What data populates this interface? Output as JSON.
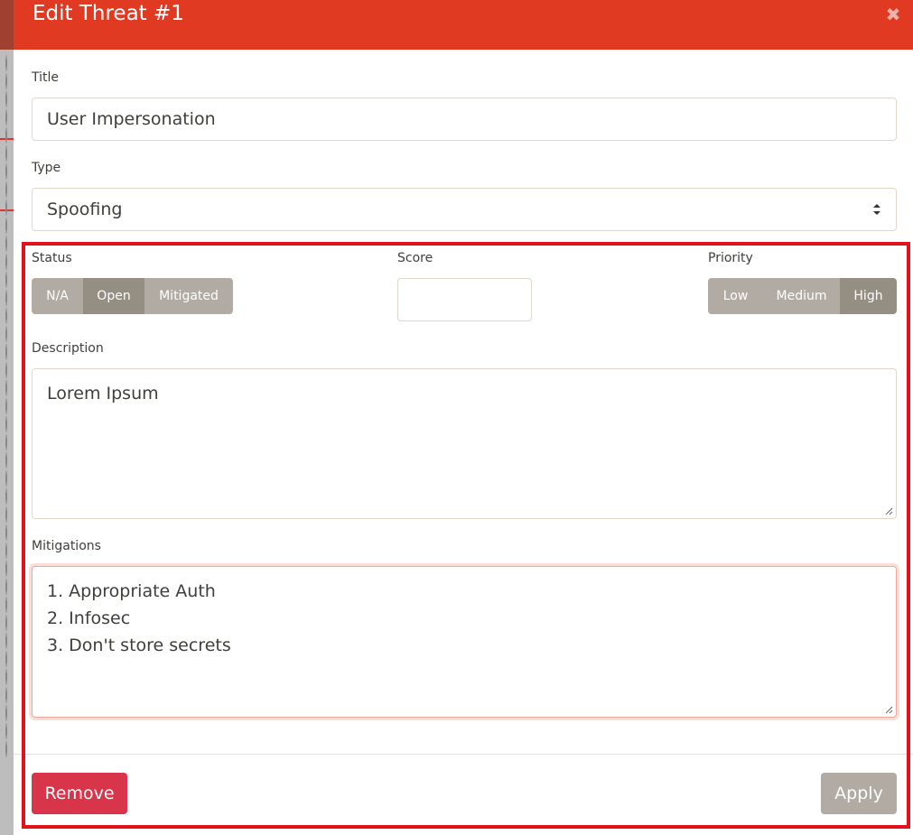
{
  "modal": {
    "title": "Edit Threat #1",
    "close_icon": "close-icon",
    "header_color": "#e03a22"
  },
  "form": {
    "title_label": "Title",
    "title_value": "User Impersonation",
    "type_label": "Type",
    "type_value": "Spoofing",
    "status_label": "Status",
    "status_options": [
      "N/A",
      "Open",
      "Mitigated"
    ],
    "status_selected": "Open",
    "score_label": "Score",
    "score_value": "",
    "priority_label": "Priority",
    "priority_options": [
      "Low",
      "Medium",
      "High"
    ],
    "priority_selected": "High",
    "description_label": "Description",
    "description_value": "Lorem Ipsum",
    "mitigations_label": "Mitigations",
    "mitigations_lines": [
      "1. Appropriate Auth",
      "2. Infosec",
      "3. Don't store secrets"
    ]
  },
  "footer": {
    "remove_label": "Remove",
    "apply_label": "Apply"
  },
  "colors": {
    "danger": "#d9354a",
    "secondary": "#b1aba3",
    "active_segment": "#958e83",
    "highlight": "#e2111b"
  }
}
